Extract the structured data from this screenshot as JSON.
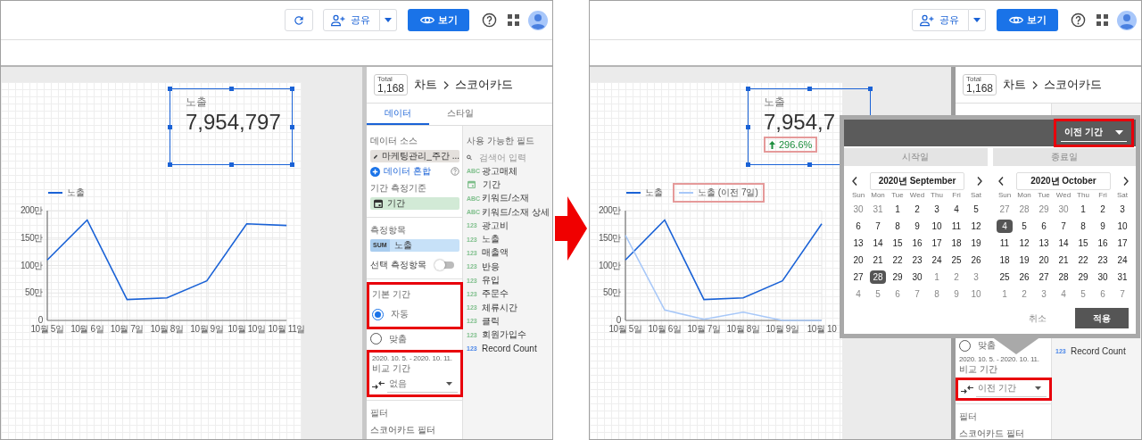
{
  "panels": [
    {
      "toolbar": {
        "buttons": [
          {
            "kind": "refresh"
          },
          {
            "kind": "share",
            "label": "공유"
          },
          {
            "kind": "view",
            "label": "보기"
          },
          {
            "kind": "help"
          },
          {
            "kind": "apps"
          },
          {
            "kind": "avatar"
          }
        ]
      },
      "scorecard": {
        "label": "노출",
        "value": "7,954,797",
        "selected": true
      },
      "chart": {
        "legend": [
          {
            "highlighted": false
          }
        ],
        "chart_data": {
          "type": "line",
          "grid": true,
          "legend": "top",
          "categories": [
            "10월 5일",
            "10월 6일",
            "10월 7일",
            "10월 8일",
            "10월 9일",
            "10월 10일",
            "10월 11일"
          ],
          "ylim": [
            0,
            200
          ],
          "yticks": [
            {
              "value": 0,
              "label": "0"
            },
            {
              "value": 50,
              "label": "50만"
            },
            {
              "value": 100,
              "label": "100만"
            },
            {
              "value": 150,
              "label": "150만"
            },
            {
              "value": 200,
              "label": "200만"
            }
          ],
          "series": [
            {
              "name": "노출",
              "color": "#1a62d6",
              "values": [
                110,
                183,
                38,
                41,
                72,
                176,
                173
              ]
            }
          ]
        }
      },
      "side_panel": {
        "total_badge": {
          "label": "Total",
          "value": "1,168"
        },
        "breadcrumb": [
          "차트",
          "스코어카드"
        ],
        "tabs": [
          {
            "label": "데이터",
            "selected": true
          },
          {
            "label": "스타일",
            "selected": false
          }
        ],
        "data_source": {
          "heading": "데이터 소스",
          "name": "마케팅관리_주간 ...",
          "blend_label": "데이터 혼합"
        },
        "date_dimension": {
          "heading": "기간 측정기준",
          "field": "기간"
        },
        "metric": {
          "heading": "측정항목",
          "aggregation": "SUM",
          "field": "노출"
        },
        "optional_metrics": {
          "label": "선택 측정항목",
          "on": false
        },
        "default_range": {
          "heading": "기본 기간",
          "highlighted": true,
          "options": [
            {
              "label": "자동",
              "selected": true
            },
            {
              "label": "맞춤",
              "selected": false
            }
          ]
        },
        "compare": {
          "range": "2020. 10. 5. - 2020. 10. 11.",
          "heading": "비교 기간",
          "highlighted": true,
          "dropdown": {
            "value": "없음",
            "highlighted": false
          }
        },
        "filter": {
          "heading": "필터",
          "label": "스코어카드 필터"
        },
        "fields": {
          "heading": "사용 가능한 필드",
          "search_placeholder": "검색어 입력",
          "items": [
            {
              "kind": "text",
              "badge": "ABC",
              "name": "광고매체"
            },
            {
              "kind": "date",
              "name": "기간"
            },
            {
              "kind": "text",
              "badge": "ABC",
              "name": "키워드/소재"
            },
            {
              "kind": "text",
              "badge": "ABC",
              "name": "키워드/소재 상세"
            },
            {
              "kind": "number",
              "badge": "123",
              "name": "광고비"
            },
            {
              "kind": "number",
              "badge": "123",
              "name": "노출"
            },
            {
              "kind": "number",
              "badge": "123",
              "name": "매출액"
            },
            {
              "kind": "number",
              "badge": "123",
              "name": "반응"
            },
            {
              "kind": "number",
              "badge": "123",
              "name": "유입"
            },
            {
              "kind": "number",
              "badge": "123",
              "name": "주문수"
            },
            {
              "kind": "number",
              "badge": "123",
              "name": "체류시간"
            },
            {
              "kind": "number",
              "badge": "123",
              "name": "클릭"
            },
            {
              "kind": "number",
              "badge": "123",
              "name": "회원가입수"
            },
            {
              "kind": "count",
              "badge": "123",
              "name": "Record Count"
            }
          ]
        }
      }
    },
    {
      "toolbar": {
        "buttons": [
          {
            "kind": "share",
            "label": "공유"
          },
          {
            "kind": "view",
            "label": "보기"
          },
          {
            "kind": "help"
          },
          {
            "kind": "apps"
          },
          {
            "kind": "avatar"
          }
        ]
      },
      "scorecard": {
        "label": "노출",
        "value": "7,954,7",
        "selected": true,
        "delta": {
          "positive": true,
          "text": "296.6%",
          "highlighted": true,
          "highlight_soft": true
        }
      },
      "chart": {
        "legend": [
          {
            "highlighted": false
          },
          {
            "highlighted": true,
            "highlight_soft": true
          }
        ],
        "chart_data": {
          "type": "line",
          "grid": true,
          "legend": "top",
          "categories": [
            "10월 5일",
            "10월 6일",
            "10월 7일",
            "10월 8일",
            "10월 9일",
            "10월 10"
          ],
          "ylim": [
            0,
            200
          ],
          "yticks": [
            {
              "value": 0,
              "label": "0"
            },
            {
              "value": 50,
              "label": "50만"
            },
            {
              "value": 100,
              "label": "100만"
            },
            {
              "value": 150,
              "label": "150만"
            },
            {
              "value": 200,
              "label": "200만"
            }
          ],
          "series": [
            {
              "name": "노출",
              "color": "#1a62d6",
              "values": [
                110,
                183,
                38,
                41,
                72,
                176
              ]
            },
            {
              "name": "노출 (이전 7일)",
              "color": "#a8c8f8",
              "values": [
                155,
                19,
                2,
                15,
                0,
                0
              ]
            }
          ]
        }
      },
      "side_panel": {
        "total_badge": {
          "label": "Total",
          "value": "1,168"
        },
        "breadcrumb": [
          "차트",
          "스코어카드"
        ],
        "default_range": {
          "highlighted": false,
          "options": [
            {
              "label": "맞춤",
              "selected": false
            }
          ]
        },
        "compare": {
          "range": "2020. 10. 5. - 2020. 10. 11.",
          "heading": "비교 기간",
          "highlighted": false,
          "dropdown": {
            "value": "이전 기간",
            "highlighted": true
          }
        },
        "filter": {
          "heading": "필터",
          "label": "스코어카드 필터"
        },
        "fields": {
          "items": [
            {
              "kind": "count",
              "badge": "123",
              "name": "Record Count"
            }
          ]
        }
      },
      "popup": {
        "mode": {
          "value": "이전 기간",
          "highlighted": true
        },
        "tabs": [
          {
            "label": "시작일"
          },
          {
            "label": "종료일"
          }
        ],
        "calendars": [
          {
            "month": "2020년 September",
            "weekdays": [
              "Sun",
              "Mon",
              "Tue",
              "Wed",
              "Thu",
              "Fri",
              "Sat"
            ],
            "weeks": [
              [
                {
                  "day": "30",
                  "muted": true,
                  "selected": false
                },
                {
                  "day": "31",
                  "muted": true,
                  "selected": false
                },
                {
                  "day": "1",
                  "muted": false,
                  "selected": false
                },
                {
                  "day": "2",
                  "muted": false,
                  "selected": false
                },
                {
                  "day": "3",
                  "muted": false,
                  "selected": false
                },
                {
                  "day": "4",
                  "muted": false,
                  "selected": false
                },
                {
                  "day": "5",
                  "muted": false,
                  "selected": false
                }
              ],
              [
                {
                  "day": "6",
                  "muted": false,
                  "selected": false
                },
                {
                  "day": "7",
                  "muted": false,
                  "selected": false
                },
                {
                  "day": "8",
                  "muted": false,
                  "selected": false
                },
                {
                  "day": "9",
                  "muted": false,
                  "selected": false
                },
                {
                  "day": "10",
                  "muted": false,
                  "selected": false
                },
                {
                  "day": "11",
                  "muted": false,
                  "selected": false
                },
                {
                  "day": "12",
                  "muted": false,
                  "selected": false
                }
              ],
              [
                {
                  "day": "13",
                  "muted": false,
                  "selected": false
                },
                {
                  "day": "14",
                  "muted": false,
                  "selected": false
                },
                {
                  "day": "15",
                  "muted": false,
                  "selected": false
                },
                {
                  "day": "16",
                  "muted": false,
                  "selected": false
                },
                {
                  "day": "17",
                  "muted": false,
                  "selected": false
                },
                {
                  "day": "18",
                  "muted": false,
                  "selected": false
                },
                {
                  "day": "19",
                  "muted": false,
                  "selected": false
                }
              ],
              [
                {
                  "day": "20",
                  "muted": false,
                  "selected": false
                },
                {
                  "day": "21",
                  "muted": false,
                  "selected": false
                },
                {
                  "day": "22",
                  "muted": false,
                  "selected": false
                },
                {
                  "day": "23",
                  "muted": false,
                  "selected": false
                },
                {
                  "day": "24",
                  "muted": false,
                  "selected": false
                },
                {
                  "day": "25",
                  "muted": false,
                  "selected": false
                },
                {
                  "day": "26",
                  "muted": false,
                  "selected": false
                }
              ],
              [
                {
                  "day": "27",
                  "muted": false,
                  "selected": false
                },
                {
                  "day": "28",
                  "muted": false,
                  "selected": true
                },
                {
                  "day": "29",
                  "muted": false,
                  "selected": false
                },
                {
                  "day": "30",
                  "muted": false,
                  "selected": false
                },
                {
                  "day": "1",
                  "muted": true,
                  "selected": false
                },
                {
                  "day": "2",
                  "muted": true,
                  "selected": false
                },
                {
                  "day": "3",
                  "muted": true,
                  "selected": false
                }
              ],
              [
                {
                  "day": "4",
                  "muted": true,
                  "selected": false
                },
                {
                  "day": "5",
                  "muted": true,
                  "selected": false
                },
                {
                  "day": "6",
                  "muted": true,
                  "selected": false
                },
                {
                  "day": "7",
                  "muted": true,
                  "selected": false
                },
                {
                  "day": "8",
                  "muted": true,
                  "selected": false
                },
                {
                  "day": "9",
                  "muted": true,
                  "selected": false
                },
                {
                  "day": "10",
                  "muted": true,
                  "selected": false
                }
              ]
            ]
          },
          {
            "month": "2020년 October",
            "weekdays": [
              "Sun",
              "Mon",
              "Tue",
              "Wed",
              "Thu",
              "Fri",
              "Sat"
            ],
            "weeks": [
              [
                {
                  "day": "27",
                  "muted": true,
                  "selected": false
                },
                {
                  "day": "28",
                  "muted": true,
                  "selected": false
                },
                {
                  "day": "29",
                  "muted": true,
                  "selected": false
                },
                {
                  "day": "30",
                  "muted": true,
                  "selected": false
                },
                {
                  "day": "1",
                  "muted": false,
                  "selected": false
                },
                {
                  "day": "2",
                  "muted": false,
                  "selected": false
                },
                {
                  "day": "3",
                  "muted": false,
                  "selected": false
                }
              ],
              [
                {
                  "day": "4",
                  "muted": false,
                  "selected": true
                },
                {
                  "day": "5",
                  "muted": false,
                  "selected": false
                },
                {
                  "day": "6",
                  "muted": false,
                  "selected": false
                },
                {
                  "day": "7",
                  "muted": false,
                  "selected": false
                },
                {
                  "day": "8",
                  "muted": false,
                  "selected": false
                },
                {
                  "day": "9",
                  "muted": false,
                  "selected": false
                },
                {
                  "day": "10",
                  "muted": false,
                  "selected": false
                }
              ],
              [
                {
                  "day": "11",
                  "muted": false,
                  "selected": false
                },
                {
                  "day": "12",
                  "muted": false,
                  "selected": false
                },
                {
                  "day": "13",
                  "muted": false,
                  "selected": false
                },
                {
                  "day": "14",
                  "muted": false,
                  "selected": false
                },
                {
                  "day": "15",
                  "muted": false,
                  "selected": false
                },
                {
                  "day": "16",
                  "muted": false,
                  "selected": false
                },
                {
                  "day": "17",
                  "muted": false,
                  "selected": false
                }
              ],
              [
                {
                  "day": "18",
                  "muted": false,
                  "selected": false
                },
                {
                  "day": "19",
                  "muted": false,
                  "selected": false
                },
                {
                  "day": "20",
                  "muted": false,
                  "selected": false
                },
                {
                  "day": "21",
                  "muted": false,
                  "selected": false
                },
                {
                  "day": "22",
                  "muted": false,
                  "selected": false
                },
                {
                  "day": "23",
                  "muted": false,
                  "selected": false
                },
                {
                  "day": "24",
                  "muted": false,
                  "selected": false
                }
              ],
              [
                {
                  "day": "25",
                  "muted": false,
                  "selected": false
                },
                {
                  "day": "26",
                  "muted": false,
                  "selected": false
                },
                {
                  "day": "27",
                  "muted": false,
                  "selected": false
                },
                {
                  "day": "28",
                  "muted": false,
                  "selected": false
                },
                {
                  "day": "29",
                  "muted": false,
                  "selected": false
                },
                {
                  "day": "30",
                  "muted": false,
                  "selected": false
                },
                {
                  "day": "31",
                  "muted": false,
                  "selected": false
                }
              ],
              [
                {
                  "day": "1",
                  "muted": true,
                  "selected": false
                },
                {
                  "day": "2",
                  "muted": true,
                  "selected": false
                },
                {
                  "day": "3",
                  "muted": true,
                  "selected": false
                },
                {
                  "day": "4",
                  "muted": true,
                  "selected": false
                },
                {
                  "day": "5",
                  "muted": true,
                  "selected": false
                },
                {
                  "day": "6",
                  "muted": true,
                  "selected": false
                },
                {
                  "day": "7",
                  "muted": true,
                  "selected": false
                }
              ]
            ]
          }
        ],
        "cancel": "취소",
        "apply": "적용"
      }
    }
  ]
}
